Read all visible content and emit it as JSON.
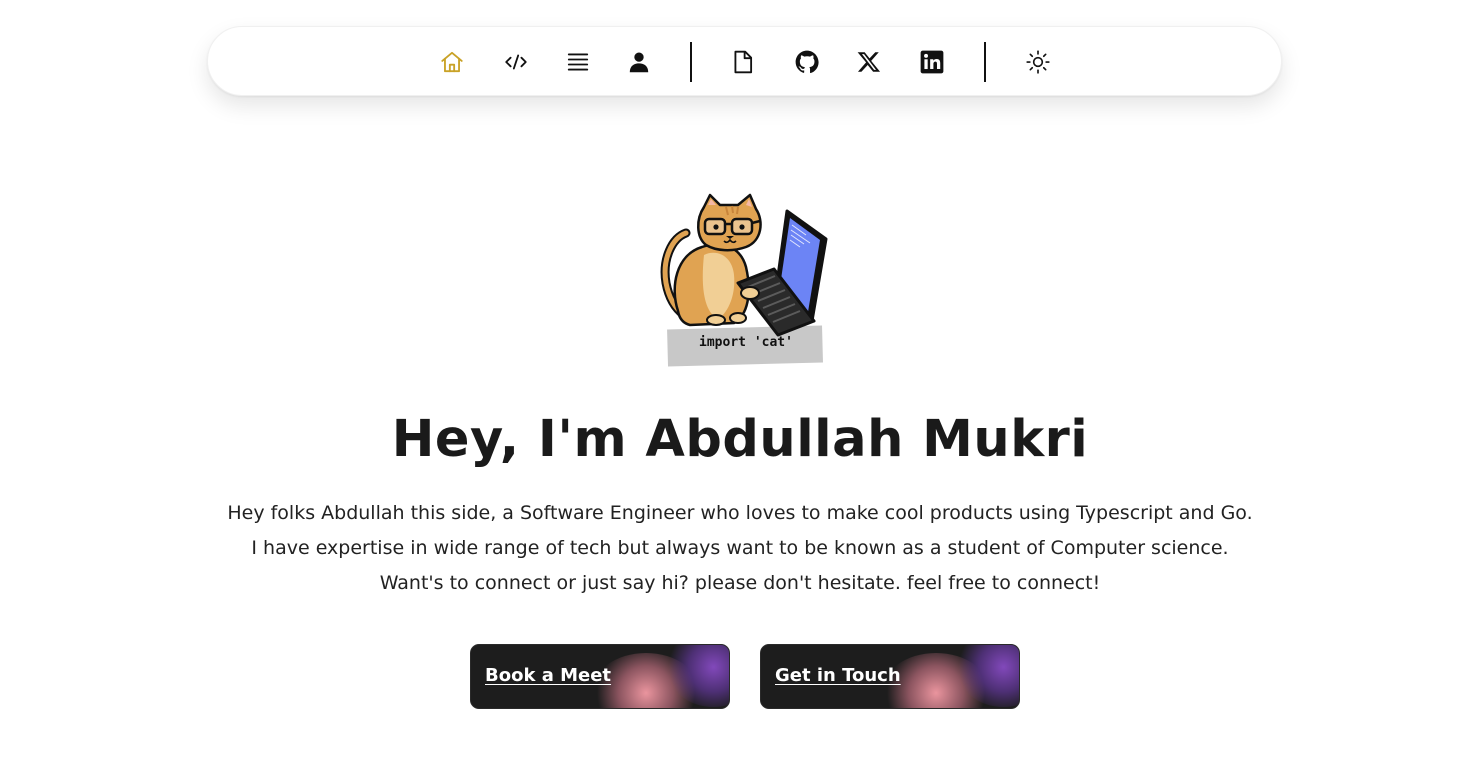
{
  "nav": {
    "items": [
      {
        "name": "home",
        "icon": "home-icon",
        "active": true
      },
      {
        "name": "projects",
        "icon": "code-icon"
      },
      {
        "name": "blog",
        "icon": "list-icon"
      },
      {
        "name": "about",
        "icon": "user-icon"
      },
      {
        "name": "resume",
        "icon": "file-icon"
      },
      {
        "name": "github",
        "icon": "github-icon"
      },
      {
        "name": "x",
        "icon": "x-icon"
      },
      {
        "name": "linkedin",
        "icon": "linkedin-icon"
      },
      {
        "name": "theme-toggle",
        "icon": "sun-icon"
      }
    ],
    "active_color": "#c9a227"
  },
  "avatar": {
    "caption": "import 'cat'"
  },
  "hero": {
    "title": "Hey, I'm Abdullah Mukri",
    "bio_lines": [
      "Hey folks Abdullah this side, a Software Engineer who loves to make cool products using Typescript and Go.",
      "I have expertise in wide range of tech but always want to be known as a student of Computer science.",
      "Want's to connect or just say hi? please don't hesitate. feel free to connect!"
    ]
  },
  "buttons": {
    "book_meet": "Book a Meet",
    "get_in_touch": "Get in Touch"
  },
  "colors": {
    "button_bg": "#1d1d1d",
    "text": "#1f1f1f",
    "accent_pink": "#f59ba5",
    "accent_purple": "#874bc3"
  }
}
